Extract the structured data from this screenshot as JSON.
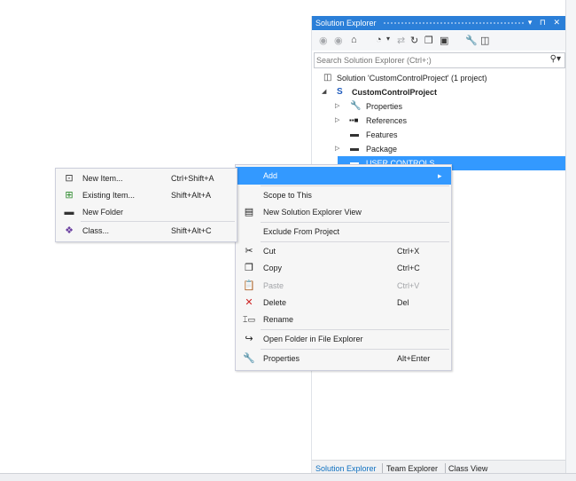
{
  "solution_explorer": {
    "title": "Solution Explorer",
    "title_buttons": "▾ ⊓ ✕",
    "toolbar_icons": [
      "back-icon",
      "forward-icon",
      "home-icon",
      "history-icon",
      "dropdown-icon",
      "sync-icon",
      "refresh-icon",
      "collapse-all-icon",
      "show-all-files-icon",
      "properties-icon",
      "preview-icon"
    ],
    "search_placeholder": "Search Solution Explorer (Ctrl+;)",
    "tree": {
      "solution": "Solution 'CustomControlProject' (1 project)",
      "project": "CustomControlProject",
      "items": [
        "Properties",
        "References",
        "Features",
        "Package",
        "USER CONTROLS"
      ]
    },
    "bottom_tabs": [
      "Solution Explorer",
      "Team Explorer",
      "Class View"
    ],
    "colors": {
      "accent": "#2b7fd8",
      "selection": "#3399ff"
    }
  },
  "context_menu": {
    "items": [
      {
        "label": "Add",
        "shortcut": "",
        "arrow": "▸",
        "icon": ""
      },
      {
        "label": "Scope to This",
        "shortcut": "",
        "icon": ""
      },
      {
        "label": "New Solution Explorer View",
        "shortcut": "",
        "icon": "new-view-icon"
      },
      {
        "label": "Exclude From Project",
        "shortcut": "",
        "icon": ""
      },
      {
        "label": "Cut",
        "shortcut": "Ctrl+X",
        "icon": "scissors-icon"
      },
      {
        "label": "Copy",
        "shortcut": "Ctrl+C",
        "icon": "copy-icon"
      },
      {
        "label": "Paste",
        "shortcut": "Ctrl+V",
        "icon": "paste-icon",
        "disabled": true
      },
      {
        "label": "Delete",
        "shortcut": "Del",
        "icon": "delete-icon"
      },
      {
        "label": "Rename",
        "shortcut": "",
        "icon": "rename-icon"
      },
      {
        "label": "Open Folder in File Explorer",
        "shortcut": "",
        "icon": "open-folder-icon"
      },
      {
        "label": "Properties",
        "shortcut": "Alt+Enter",
        "icon": "wrench-icon"
      }
    ]
  },
  "add_submenu": {
    "items": [
      {
        "label": "New Item...",
        "shortcut": "Ctrl+Shift+A",
        "icon": "new-item-icon"
      },
      {
        "label": "Existing Item...",
        "shortcut": "Shift+Alt+A",
        "icon": "existing-item-icon"
      },
      {
        "label": "New Folder",
        "shortcut": "",
        "icon": "new-folder-icon"
      },
      {
        "label": "Class...",
        "shortcut": "Shift+Alt+C",
        "icon": "class-icon"
      }
    ]
  }
}
